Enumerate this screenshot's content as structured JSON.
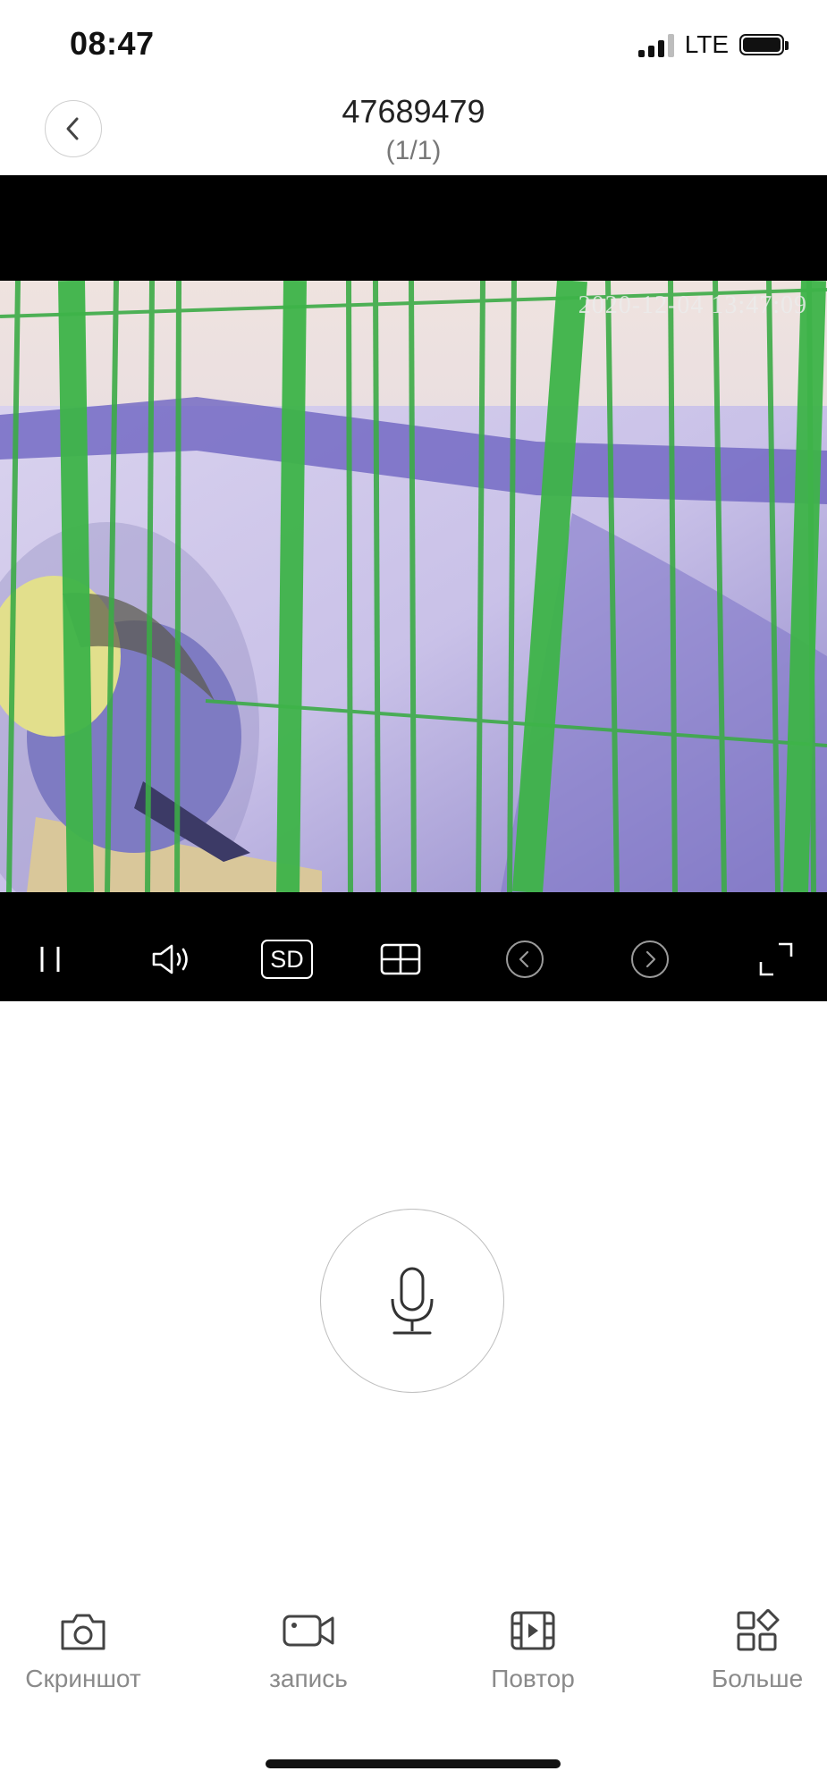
{
  "status_bar": {
    "time": "08:47",
    "network": "LTE",
    "icons": [
      "signal-icon",
      "battery-icon"
    ]
  },
  "header": {
    "title": "47689479",
    "subtitle": "(1/1)",
    "back_icon": "chevron-left-icon"
  },
  "player": {
    "timestamp": "2020-12-04  13:47:09",
    "controls": {
      "pause_icon": "pause-icon",
      "volume_icon": "volume-icon",
      "quality_label": "SD",
      "grid_icon": "grid-icon",
      "prev_icon": "chevron-left-circle-icon",
      "next_icon": "chevron-right-circle-icon",
      "fullscreen_icon": "fullscreen-icon"
    }
  },
  "talk": {
    "icon": "microphone-icon"
  },
  "tabs": [
    {
      "label": "Скриншот",
      "icon": "camera-icon"
    },
    {
      "label": "запись",
      "icon": "video-camera-icon"
    },
    {
      "label": "Повтор",
      "icon": "film-icon"
    },
    {
      "label": "Больше",
      "icon": "apps-icon"
    }
  ],
  "colors": {
    "background": "#ffffff",
    "player_background": "#000000",
    "icon_gray": "#555555",
    "label_gray": "#8a8a8a"
  }
}
